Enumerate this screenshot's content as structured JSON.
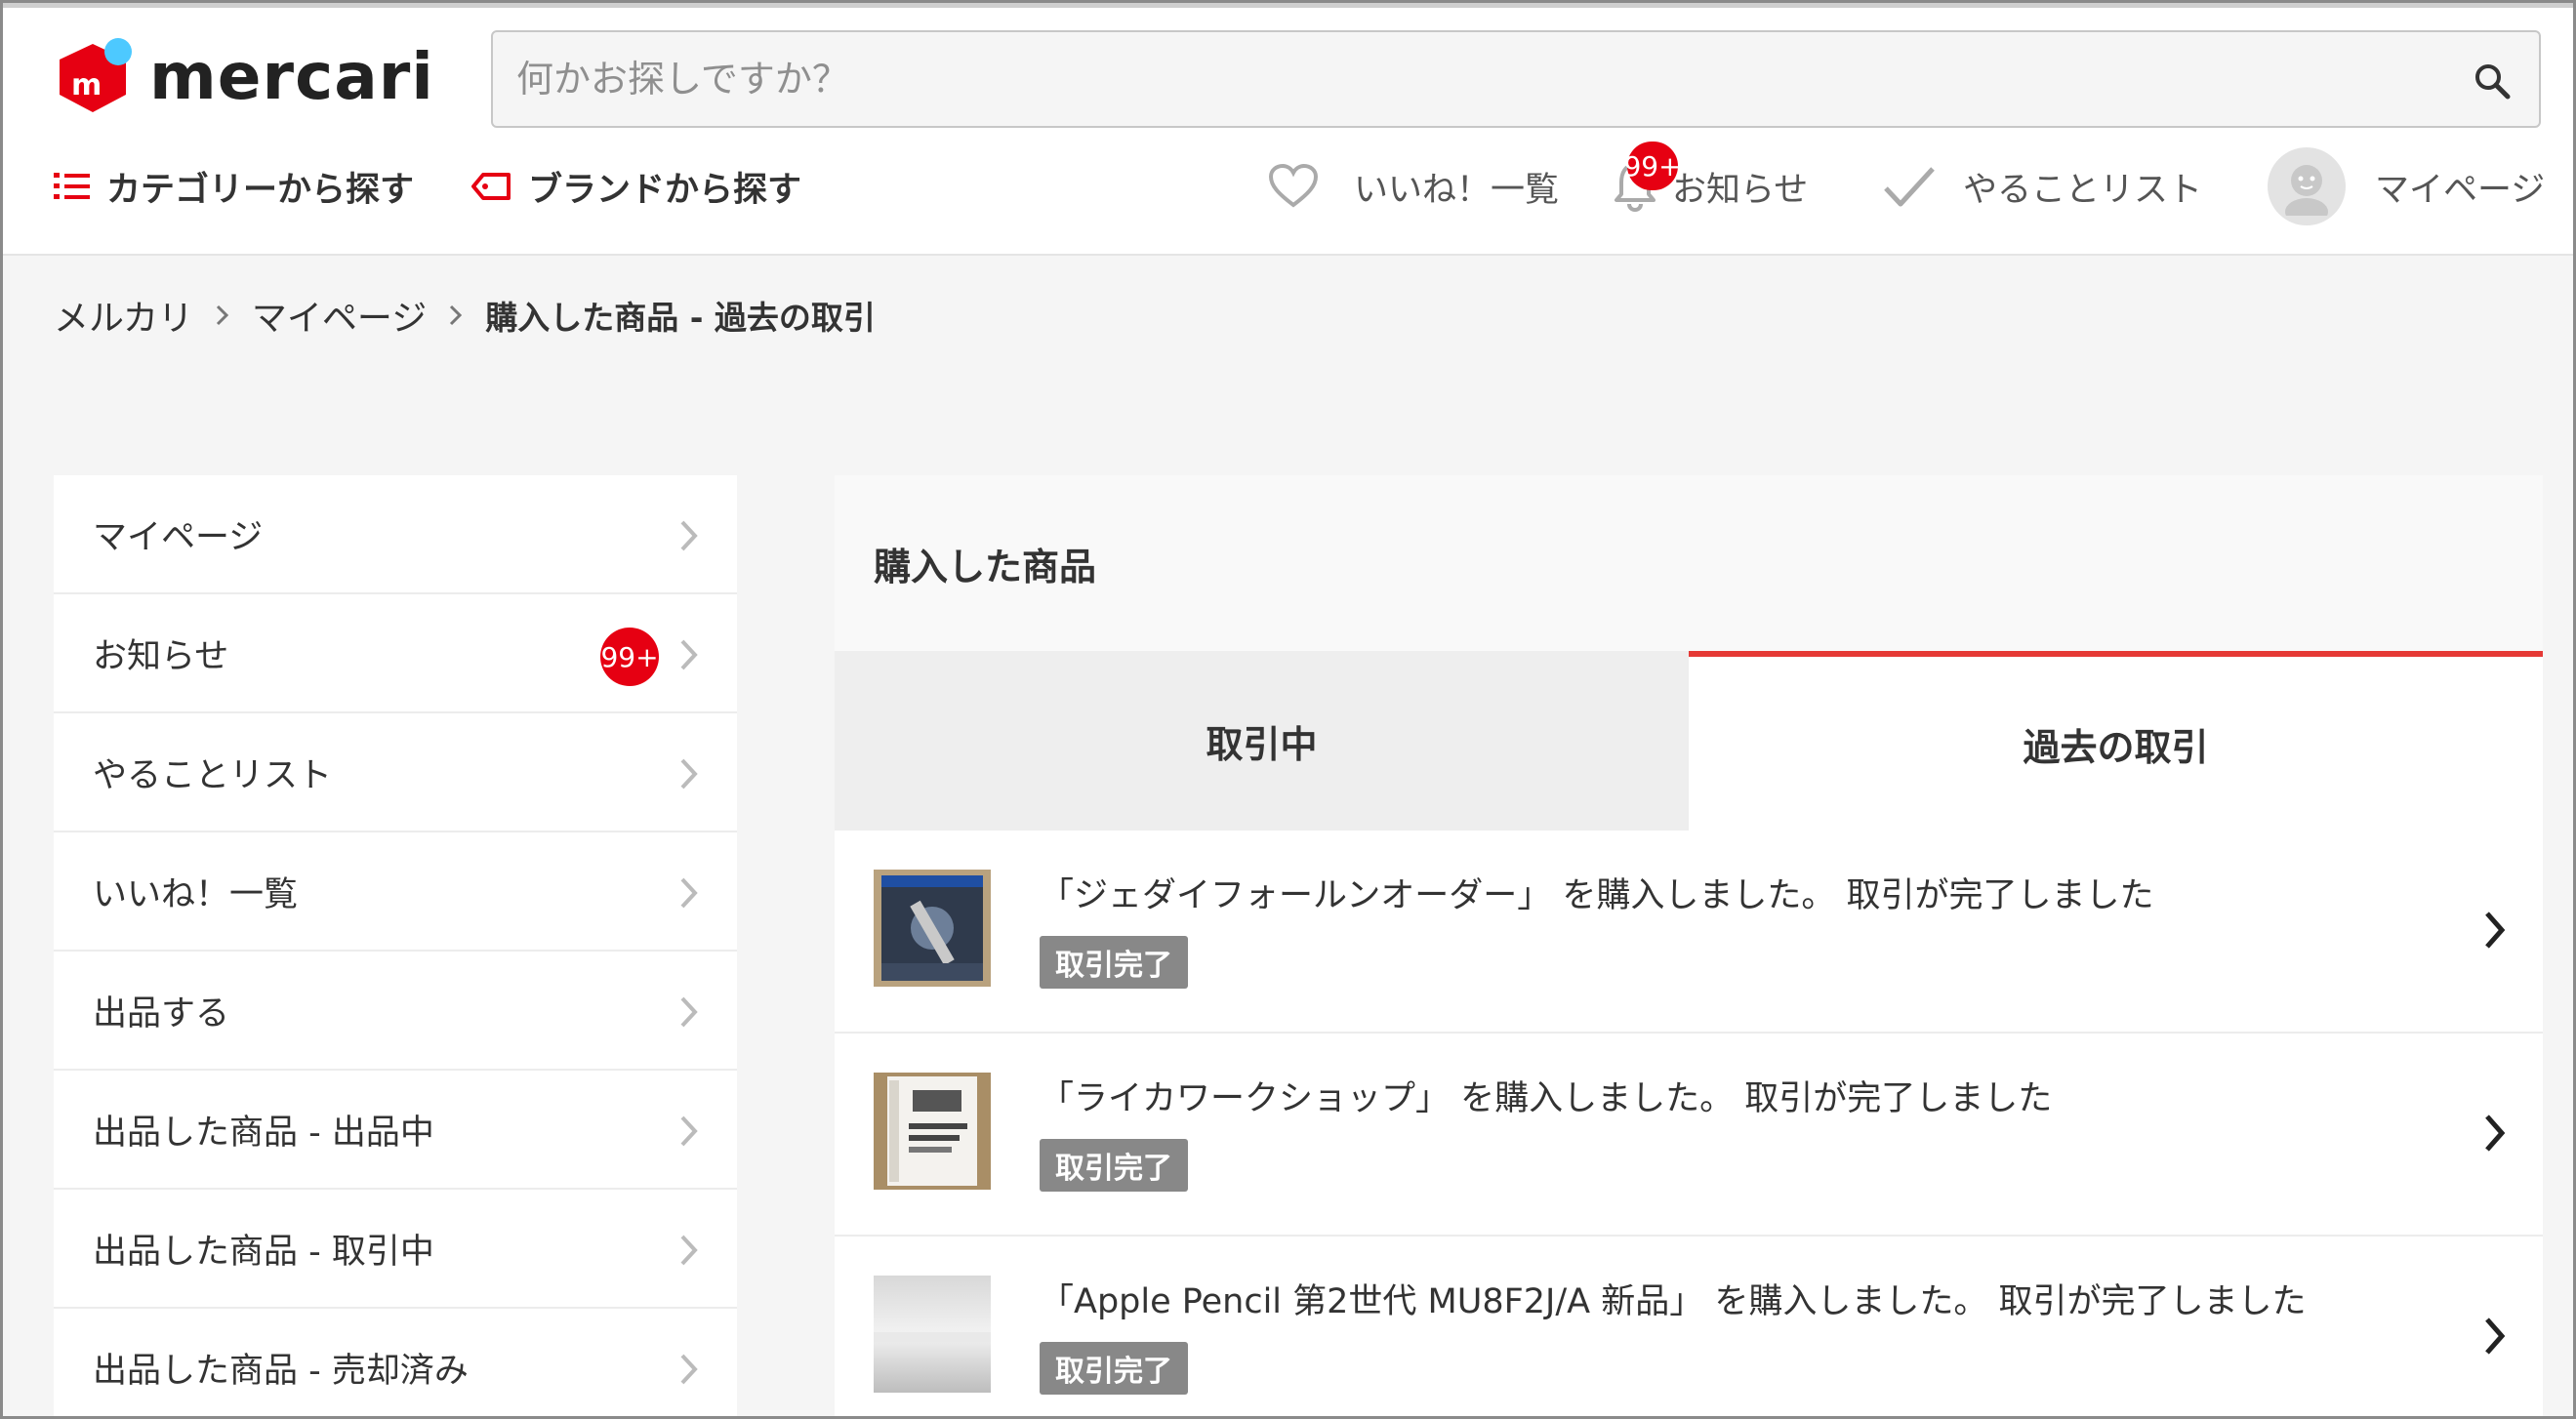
{
  "header": {
    "logo_text": "mercari",
    "search_placeholder": "何かお探しですか？",
    "nav_left": [
      {
        "label": "カテゴリーから探す",
        "icon": "list-icon"
      },
      {
        "label": "ブランドから探す",
        "icon": "tag-icon"
      }
    ],
    "nav_right": [
      {
        "label": "いいね！一覧",
        "icon": "heart-icon"
      },
      {
        "label": "お知らせ",
        "icon": "bell-icon",
        "badge": "99+"
      },
      {
        "label": "やることリスト",
        "icon": "check-icon"
      },
      {
        "label": "マイページ",
        "icon": "avatar-icon"
      }
    ]
  },
  "breadcrumb": [
    "メルカリ",
    "マイページ",
    "購入した商品 - 過去の取引"
  ],
  "sidebar": {
    "items": [
      {
        "label": "マイページ"
      },
      {
        "label": "お知らせ",
        "badge": "99+"
      },
      {
        "label": "やることリスト"
      },
      {
        "label": "いいね！一覧"
      },
      {
        "label": "出品する"
      },
      {
        "label": "出品した商品 - 出品中"
      },
      {
        "label": "出品した商品 - 取引中"
      },
      {
        "label": "出品した商品 - 売却済み"
      }
    ]
  },
  "main": {
    "title": "購入した商品",
    "tabs": [
      {
        "label": "取引中",
        "active": false
      },
      {
        "label": "過去の取引",
        "active": true
      }
    ],
    "transactions": [
      {
        "title": "「ジェダイフォールンオーダー」 を購入しました。 取引が完了しました",
        "status": "取引完了"
      },
      {
        "title": "「ライカワークショップ」 を購入しました。 取引が完了しました",
        "status": "取引完了"
      },
      {
        "title": "「Apple Pencil 第2世代 MU8F2J/A 新品」 を購入しました。 取引が完了しました",
        "status": "取引完了"
      }
    ]
  },
  "colors": {
    "brand_red": "#e60012",
    "tab_accent": "#e53935",
    "status_gray": "#888888",
    "logo_blue": "#4dc9ff"
  }
}
